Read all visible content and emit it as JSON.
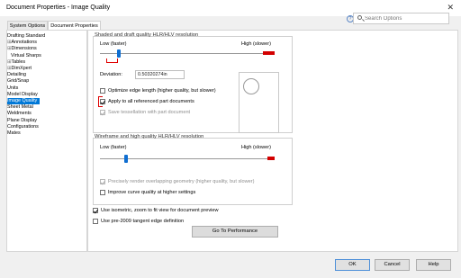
{
  "window": {
    "title": "Document Properties - Image Quality",
    "close_symbol": "✕"
  },
  "tabs": {
    "system": "System Options",
    "document": "Document Properties"
  },
  "search": {
    "placeholder": "Search Options",
    "help_symbol": "?"
  },
  "tree": [
    {
      "label": "Drafting Standard",
      "toggle": "",
      "selected": false
    },
    {
      "label": "Annotations",
      "toggle": "⊞",
      "selected": false
    },
    {
      "label": "Dimensions",
      "toggle": "⊞",
      "selected": false
    },
    {
      "label": "Virtual Sharps",
      "toggle": "",
      "selected": false
    },
    {
      "label": "Tables",
      "toggle": "⊞",
      "selected": false
    },
    {
      "label": "DimXpert",
      "toggle": "⊞",
      "selected": false
    },
    {
      "label": "Detailing",
      "toggle": "",
      "selected": false
    },
    {
      "label": "Grid/Snap",
      "toggle": "",
      "selected": false
    },
    {
      "label": "Units",
      "toggle": "",
      "selected": false
    },
    {
      "label": "Model Display",
      "toggle": "",
      "selected": false
    },
    {
      "label": "Image Quality",
      "toggle": "",
      "selected": true
    },
    {
      "label": "Sheet Metal",
      "toggle": "",
      "selected": false
    },
    {
      "label": "Weldments",
      "toggle": "",
      "selected": false
    },
    {
      "label": "Plane Display",
      "toggle": "",
      "selected": false
    },
    {
      "label": "Configurations",
      "toggle": "",
      "selected": false
    },
    {
      "label": "Mates",
      "toggle": "",
      "selected": false
    }
  ],
  "shaded": {
    "title": "Shaded and draft quality HLR/HLV resolution",
    "low_label": "Low (faster)",
    "high_label": "High (slower)",
    "slider_position": 0.11,
    "deviation_label": "Deviation:",
    "deviation_value": "0.50320274in",
    "optimize_label": "Optimize edge length (higher quality, but slower)",
    "optimize_checked": false,
    "apply_label": "Apply to all referenced part documents",
    "apply_checked": true,
    "save_label": "Save tessellation with part document",
    "save_checked": true
  },
  "wireframe": {
    "title": "Wireframe and high quality HLR/HLV resolution",
    "low_label": "Low (faster)",
    "high_label": "High (slower)",
    "slider_position": 0.15,
    "precisely_label": "Precisely render overlapping geometry (higher quality, but slower)",
    "precisely_checked": true,
    "improve_label": "Improve curve quality at higher settings",
    "improve_checked": false
  },
  "options": {
    "isometric_label": "Use isometric, zoom to fit view for document preview",
    "isometric_checked": true,
    "pre2009_label": "Use pre-2009 tangent edge definition",
    "pre2009_checked": false
  },
  "buttons": {
    "performance": "Go To Performance",
    "ok": "OK",
    "cancel": "Cancel",
    "help": "Help"
  },
  "colors": {
    "accent": "#0078d7",
    "slider_end": "#d30000",
    "annotation": "#e00000"
  }
}
